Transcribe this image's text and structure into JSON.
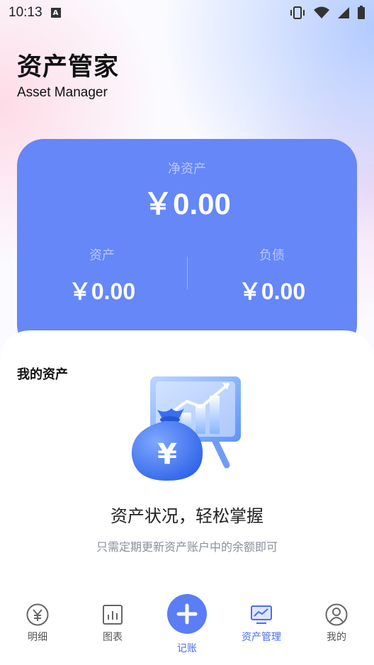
{
  "status_bar": {
    "time": "10:13",
    "notification_icon": "A"
  },
  "header": {
    "title": "资产管家",
    "subtitle": "Asset Manager"
  },
  "summary": {
    "net_label": "净资产",
    "net_value": "￥0.00",
    "assets_label": "资产",
    "assets_value": "￥0.00",
    "liabilities_label": "负债",
    "liabilities_value": "￥0.00"
  },
  "my_assets": {
    "section_title": "我的资产",
    "illustration_icon": "money-bag-chart-icon",
    "illustration_symbol": "¥",
    "empty_title": "资产状况，轻松掌握",
    "empty_subtitle": "只需定期更新资产账户中的余额即可"
  },
  "tabbar": {
    "items": [
      {
        "label": "明细",
        "icon": "yen-circle-icon"
      },
      {
        "label": "图表",
        "icon": "bar-chart-icon"
      },
      {
        "label": "记账",
        "icon": "plus-icon"
      },
      {
        "label": "资产管理",
        "icon": "trend-monitor-icon"
      },
      {
        "label": "我的",
        "icon": "user-icon"
      }
    ],
    "active_index": 3
  },
  "colors": {
    "accent": "#5b7df5",
    "card": "#6587f8",
    "active_tab": "#4a6cf0"
  }
}
